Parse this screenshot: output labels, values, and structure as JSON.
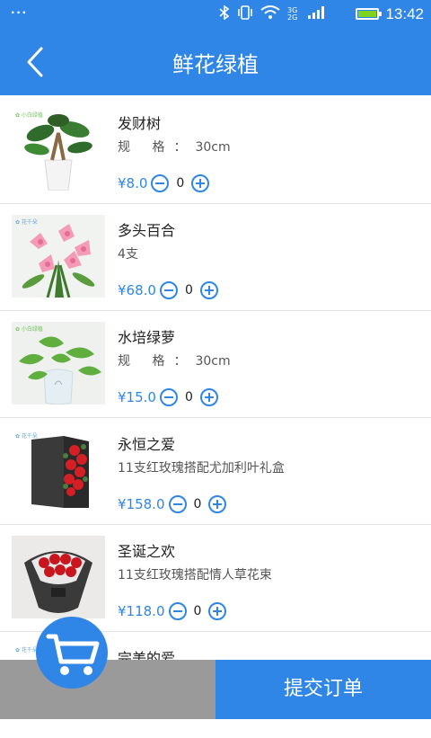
{
  "status_bar": {
    "menu_dots": "···",
    "time": "13:42",
    "network": "3G 2G"
  },
  "header": {
    "title": "鲜花绿植"
  },
  "products": [
    {
      "name": "发财树",
      "spec_label": "规 格：",
      "spec_value": "30cm",
      "price": "¥8.0",
      "quantity": "0"
    },
    {
      "name": "多头百合",
      "spec_label": "",
      "spec_value": "4支",
      "price": "¥68.0",
      "quantity": "0"
    },
    {
      "name": "水培绿萝",
      "spec_label": "规 格：",
      "spec_value": "30cm",
      "price": "¥15.0",
      "quantity": "0"
    },
    {
      "name": "永恒之爱",
      "spec_label": "",
      "spec_value": "11支红玫瑰搭配尤加利叶礼盒",
      "price": "¥158.0",
      "quantity": "0"
    },
    {
      "name": "圣诞之欢",
      "spec_label": "",
      "spec_value": "11支红玫瑰搭配情人草花束",
      "price": "¥118.0",
      "quantity": "0"
    },
    {
      "name": "完美的爱",
      "spec_label": "",
      "spec_value": "",
      "price": "",
      "quantity": ""
    }
  ],
  "footer": {
    "submit_label": "提交订单"
  },
  "colors": {
    "accent": "#2f86e6",
    "divider": "#e3e3e3",
    "footer_gray": "#9a9a9a"
  },
  "icons": [
    "back-icon",
    "cart-icon",
    "minus-icon",
    "plus-icon",
    "bluetooth-icon",
    "vibrate-icon",
    "wifi-icon",
    "signal-icon",
    "battery-icon"
  ]
}
